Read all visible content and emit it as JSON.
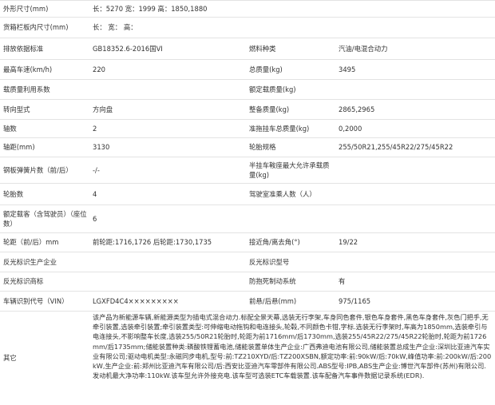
{
  "rows": [
    {
      "l1": "外形尺寸(mm)",
      "v1": "长：5270 宽：1999 高：1850,1880"
    },
    {
      "l1": "货箱栏板内尺寸(mm)",
      "v1": "长： 宽： 高："
    },
    {
      "l1": "排放依据标准",
      "v1": "GB18352.6-2016国VI",
      "l2": "燃料种类",
      "v2": "汽油/电混合动力"
    },
    {
      "l1": "最高车速(km/h)",
      "v1": "220",
      "l2": "总质量(kg)",
      "v2": "3495"
    },
    {
      "l1": "载质量利用系数",
      "v1": "",
      "l2": "额定载质量(kg)",
      "v2": ""
    },
    {
      "l1": "转向型式",
      "v1": "方向盘",
      "l2": "整备质量(kg)",
      "v2": "2865,2965"
    },
    {
      "l1": "轴数",
      "v1": "2",
      "l2": "准拖挂车总质量(kg)",
      "v2": "0,2000"
    },
    {
      "l1": "轴距(mm)",
      "v1": "3130",
      "l2": "轮胎规格",
      "v2": "255/50R21,255/45R22/275/45R22"
    },
    {
      "l1": "钢板弹簧片数（前/后）",
      "v1": "-/-",
      "l2": "半挂车鞍座最大允许承载质量(kg)",
      "v2": ""
    },
    {
      "l1": "轮胎数",
      "v1": "4",
      "l2": "驾驶室准乘人数（人）",
      "v2": ""
    },
    {
      "l1": "额定载客（含驾驶员）（座位数）",
      "v1": "6"
    },
    {
      "l1": "轮距（前/后）mm",
      "v1": "前轮距:1716,1726 后轮距:1730,1735",
      "l2": "接近角/离去角(°)",
      "v2": "19/22"
    },
    {
      "l1": "反光标识生产企业",
      "v1": "",
      "l2": "反光标识型号",
      "v2": ""
    },
    {
      "l1": "反光标识商标",
      "v1": "",
      "l2": "防抱死制动系统",
      "v2": "有"
    },
    {
      "l1": "车辆识别代号（VIN）",
      "v1": "LGXFD4C4×××××××××",
      "l2": "前悬/后悬(mm)",
      "v2": "975/1165"
    }
  ],
  "other": {
    "label": "其它",
    "text": "该产品为新能源车辆,新能源类型为插电式混合动力.标配全景天幕,选装无行李架,车身同色套件,银色车身套件,黑色车身套件,灰色门把手,无牵引装置,选装牵引装置;牵引装置类型:可伸缩电动拖钩和电连接头,轮毂,不同颜色卡钳,字标.选装无行李架时,车高为1850mm,选装牵引与电连接头,不影响整车长度,选装255/50R21轮胎时,轮距为前1716mm/后1730mm,选装255/45R22/275/45R22轮胎时,轮距为前1726mm/后1735mm;储能装置种类:磷酸铁锂蓄电池,储能装置单体生产企业:广西弗迪电池有限公司,储能装置总成生产企业:深圳比亚迪汽车实业有限公司;驱动电机类型:永磁同步电机,型号:前:TZ210XYD/后:TZ200XSBN,额定功率:前:90kW/后:70kW,峰值功率:前:200kW/后:200kW,生产企业:前:郑州比亚迪汽车有限公司/后:西安比亚迪汽车零部件有限公司.ABS型号:IPB,ABS生产企业:博世汽车部件(苏州)有限公司.发动机最大净功率:110kW.该车型允许外接充电.该车型可选装ETC车载装置.该车配备汽车事件数据记录系统(EDR)."
  }
}
